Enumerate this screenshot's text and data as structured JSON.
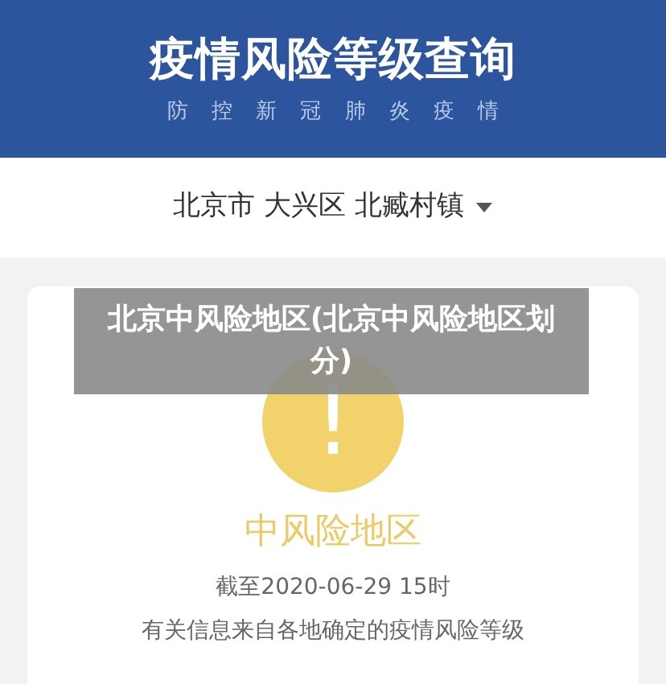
{
  "header": {
    "title": "疫情风险等级查询",
    "subtitle": "防控新冠肺炎疫情"
  },
  "location": {
    "value": "北京市 大兴区 北臧村镇"
  },
  "result": {
    "kind": "medium",
    "icon": "!",
    "label": "中风险地区",
    "date": "截至2020-06-29 15时",
    "note": "有关信息来自各地确定的疫情风险等级"
  },
  "caption": "北京中风险地区(北京中风险地区划分)"
}
